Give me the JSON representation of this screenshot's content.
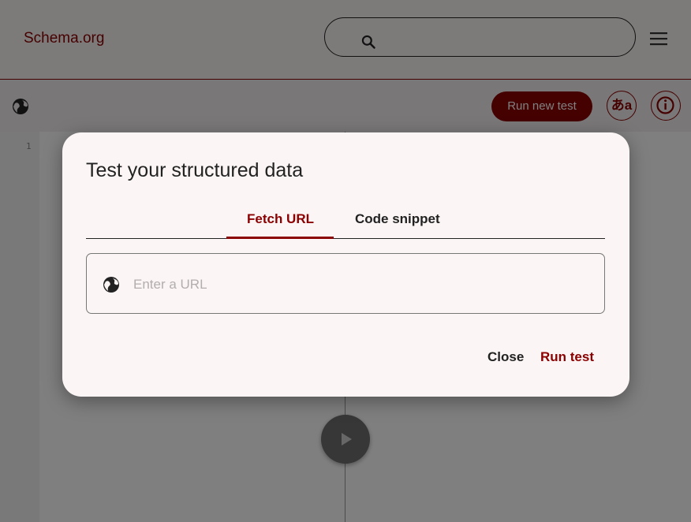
{
  "header": {
    "logo": "Schema.org",
    "search_icon": "search-icon",
    "menu_icon": "menu-icon"
  },
  "toolbar": {
    "globe_icon": "globe-icon",
    "run_new_test": "Run new test",
    "lang_label": "あa",
    "info_icon": "info-icon"
  },
  "editor": {
    "line_numbers": [
      "1"
    ],
    "play_icon": "play-icon"
  },
  "dialog": {
    "title": "Test your structured data",
    "tabs": [
      {
        "label": "Fetch URL",
        "active": true
      },
      {
        "label": "Code snippet",
        "active": false
      }
    ],
    "url_input": {
      "placeholder": "Enter a URL",
      "value": ""
    },
    "close_label": "Close",
    "run_label": "Run test"
  },
  "colors": {
    "accent": "#8b0000",
    "dialog_bg": "#fbf6f5",
    "overlay": "rgba(0,0,0,0.5)"
  }
}
